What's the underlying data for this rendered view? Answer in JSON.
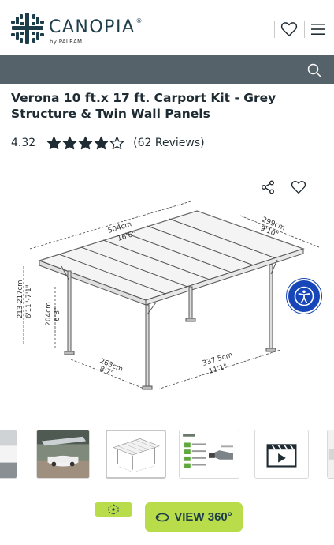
{
  "header": {
    "brand": "CANOPIA",
    "brand_mark": "®",
    "byline": "by PALRAM"
  },
  "product": {
    "title": "Verona 10 ft.x 17 ft. Carport Kit - Grey Structure & Twin Wall Panels",
    "rating_value": "4.32",
    "rating_stars": 4.32,
    "stars_max": 5,
    "reviews": "(62 Reviews)"
  },
  "diagram": {
    "width_top": "504cm",
    "width_top_ft": "16'6\"",
    "depth_top": "299cm",
    "depth_top_ft": "9'10\"",
    "height_range": "213-217cm",
    "height_range_ft": "6'11\"-7'1\"",
    "height_low": "204cm",
    "height_low_ft": "6'8\"",
    "depth_bottom": "263cm",
    "depth_bottom_ft": "8'7\"",
    "width_bottom": "337.5cm",
    "width_bottom_ft": "11'1\""
  },
  "buttons": {
    "view360": "VIEW 360°"
  },
  "colors": {
    "accent_green": "#b8dc4a",
    "searchbar": "#55626a",
    "accessibility_blue": "#1646b8"
  }
}
